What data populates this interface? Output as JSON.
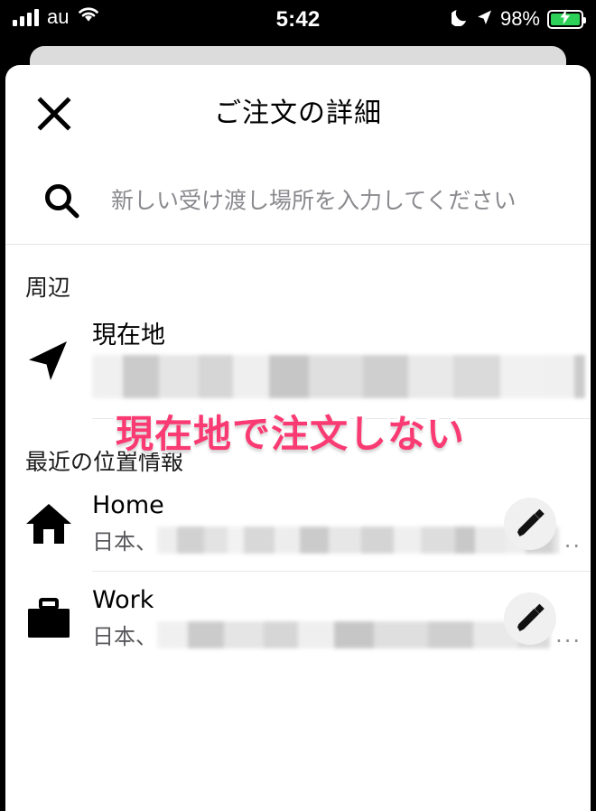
{
  "status_bar": {
    "carrier": "au",
    "time": "5:42",
    "battery_percent": "98%",
    "icons": {
      "signal": "signal-bars-icon",
      "wifi": "wifi-icon",
      "moon": "moon-icon",
      "location": "location-arrow-icon",
      "battery": "battery-charging-icon"
    },
    "battery_color": "#2ed158"
  },
  "sheet": {
    "title": "ご注文の詳細",
    "close_label": "×"
  },
  "search": {
    "value": "",
    "placeholder": "新しい受け渡し場所を入力してください"
  },
  "nearby": {
    "section_label": "周辺",
    "current_location": {
      "title": "現在地",
      "address_redacted": true
    }
  },
  "annotation": {
    "text": "現在地で注文しない",
    "color": "#fa3a72",
    "outline_color": "#ffffff"
  },
  "recent": {
    "section_label": "最近の位置情報",
    "items": [
      {
        "title": "Home",
        "icon": "home-icon",
        "address_prefix": "日本、",
        "address_redacted": true,
        "address_ellipsis": "..",
        "edit_label": "pencil-icon"
      },
      {
        "title": "Work",
        "icon": "briefcase-icon",
        "address_prefix": "日本、",
        "address_redacted": true,
        "address_ellipsis": "...",
        "edit_label": "pencil-icon"
      }
    ]
  }
}
